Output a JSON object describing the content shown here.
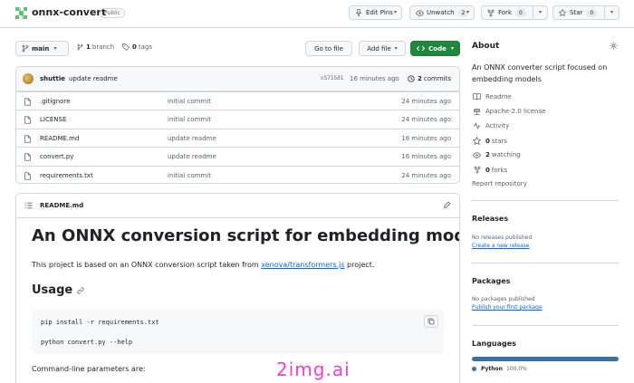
{
  "repo": {
    "name": "onnx-convert",
    "visibility": "Public",
    "actions": {
      "edit_pins": "Edit Pins",
      "unwatch": "Unwatch",
      "watch_count": "2",
      "fork": "Fork",
      "fork_count": "0",
      "star": "Star",
      "star_count": "0"
    }
  },
  "branch_bar": {
    "branch": "main",
    "branch_count": "1",
    "branch_label": "branch",
    "tag_count": "0",
    "tag_label": "tags",
    "go_to_file": "Go to file",
    "add_file": "Add file",
    "code": "Code"
  },
  "latest_commit": {
    "user": "shuttie",
    "message": "update readme",
    "hash": "c5715d1",
    "time": "16 minutes ago",
    "commits_count": "2",
    "commits_label": "commits"
  },
  "files": [
    {
      "name": ".gitignore",
      "message": "initial commit",
      "time": "24 minutes ago"
    },
    {
      "name": "LICENSE",
      "message": "initial commit",
      "time": "24 minutes ago"
    },
    {
      "name": "README.md",
      "message": "update readme",
      "time": "16 minutes ago"
    },
    {
      "name": "convert.py",
      "message": "update readme",
      "time": "16 minutes ago"
    },
    {
      "name": "requirements.txt",
      "message": "initial commit",
      "time": "24 minutes ago"
    }
  ],
  "readme": {
    "file_label": "README.md",
    "h1": "An ONNX conversion script for embedding models",
    "p1_prefix": "This project is based on an ONNX conversion script taken from ",
    "p1_link": "xenova/transformers.js",
    "p1_suffix": " project.",
    "h2": "Usage",
    "code_line1": "pip install -r requirements.txt",
    "code_line2": "python convert.py --help",
    "p2": "Command-line parameters are:"
  },
  "about": {
    "title": "About",
    "description": "An ONNX converter script focused on embedding models",
    "readme": "Readme",
    "license": "Apache-2.0 license",
    "activity": "Activity",
    "stars_count": "0",
    "stars_label": "stars",
    "watching_count": "2",
    "watching_label": "watching",
    "forks_count": "0",
    "forks_label": "forks",
    "report": "Report repository"
  },
  "releases": {
    "title": "Releases",
    "empty": "No releases published",
    "create_link": "Create a new release"
  },
  "packages": {
    "title": "Packages",
    "empty": "No packages published",
    "publish_link": "Publish your first package"
  },
  "languages": {
    "title": "Languages",
    "items": [
      {
        "name": "Python",
        "percent": "100.0%",
        "color": "#3572A5"
      }
    ]
  },
  "watermark": "2img.ai",
  "colors": {
    "accent_green": "#1f883d",
    "link_blue": "#0969da",
    "python_blue": "#3572A5"
  }
}
